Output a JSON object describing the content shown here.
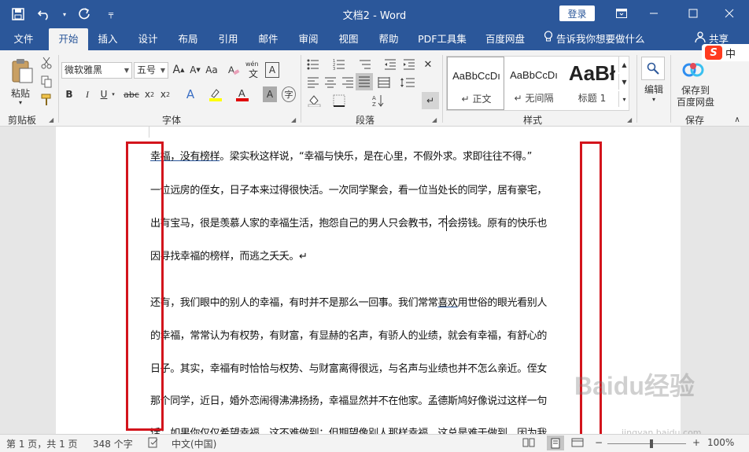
{
  "window": {
    "title": "文档2  -  Word",
    "login_label": "登录"
  },
  "quick_access": {
    "save_icon": "save-icon",
    "undo_icon": "undo-icon",
    "redo_icon": "redo-icon",
    "customize_icon": "customize-icon"
  },
  "tabs": [
    "文件",
    "开始",
    "插入",
    "设计",
    "布局",
    "引用",
    "邮件",
    "审阅",
    "视图",
    "帮助",
    "PDF工具集",
    "百度网盘"
  ],
  "active_tab": "开始",
  "tell_me": "告诉我你想要做什么",
  "share": "共享",
  "sogou": "中",
  "clipboard": {
    "paste_label": "粘贴",
    "group_label": "剪贴板"
  },
  "font": {
    "name": "微软雅黑",
    "size": "五号",
    "group_label": "字体",
    "wen_label": "wén",
    "wen_char": "文",
    "grow_label": "A",
    "a_box": "A"
  },
  "paragraph": {
    "group_label": "段落"
  },
  "styles": {
    "group_label": "样式",
    "items": [
      {
        "sample": "AaBbCcDı",
        "name": "正文",
        "prefix": "↵"
      },
      {
        "sample": "AaBbCcDı",
        "name": "无间隔",
        "prefix": "↵"
      },
      {
        "sample": "AaBł",
        "name": "标题 1",
        "prefix": ""
      }
    ]
  },
  "editing": {
    "label": "编辑"
  },
  "save_group": {
    "button_line1": "保存到",
    "button_line2": "百度网盘",
    "group_label": "保存"
  },
  "document": {
    "lines": [
      {
        "pre": "",
        "ul": "幸福，没有榜样",
        "post": "。梁实秋这样说，“幸福与快乐，是在心里，不假外求。求即往往不得。”"
      },
      {
        "pre": "一位远房的侄女，日子本来过得很快活。一次同学聚会，看一位当处长的同学，居有豪宅，",
        "ul": "",
        "post": ""
      },
      {
        "pre": "出有宝马，很是羡慕人家的幸福生活，抱怨自己的男人只会教书，不会捞钱。原有的快乐也",
        "ul": "",
        "post": ""
      },
      {
        "pre": "因寻找幸福的榜样，而逃之夭夭。↵",
        "ul": "",
        "post": ""
      },
      {
        "pre": "还有，我们眼中的别人的幸福，有时并不是那么一回事。我们常常",
        "ul": "喜欢",
        "post": "用世俗的眼光看别人"
      },
      {
        "pre": "的幸福，常常认为有权势，有财富，有显赫的名声，有骄人的业绩，就会有幸福，有舒心的",
        "ul": "",
        "post": ""
      },
      {
        "pre": "日子。其实，幸福有时恰恰与权势、与财富离得很远，与名声与业绩也并不怎么亲近。侄女",
        "ul": "",
        "post": ""
      },
      {
        "pre": "那个同学，近日，婚外恋闹得沸沸扬扬，幸福显然并不在他家。孟德斯鸠好像说过这样一句",
        "ul": "",
        "post": ""
      },
      {
        "pre": "话：如果你仅仅希望幸福，这不难做到；但期望像别人那样幸福，这总是难于做到，因为我",
        "ul": "",
        "post": ""
      }
    ]
  },
  "watermark": {
    "text": "Baidu经验",
    "url": "jingyan.baidu.com"
  },
  "status": {
    "page": "第 1 页，共 1 页",
    "words": "348 个字",
    "language": "中文(中国)",
    "zoom": "100%",
    "zoom_minus": "−",
    "zoom_plus": "+"
  }
}
